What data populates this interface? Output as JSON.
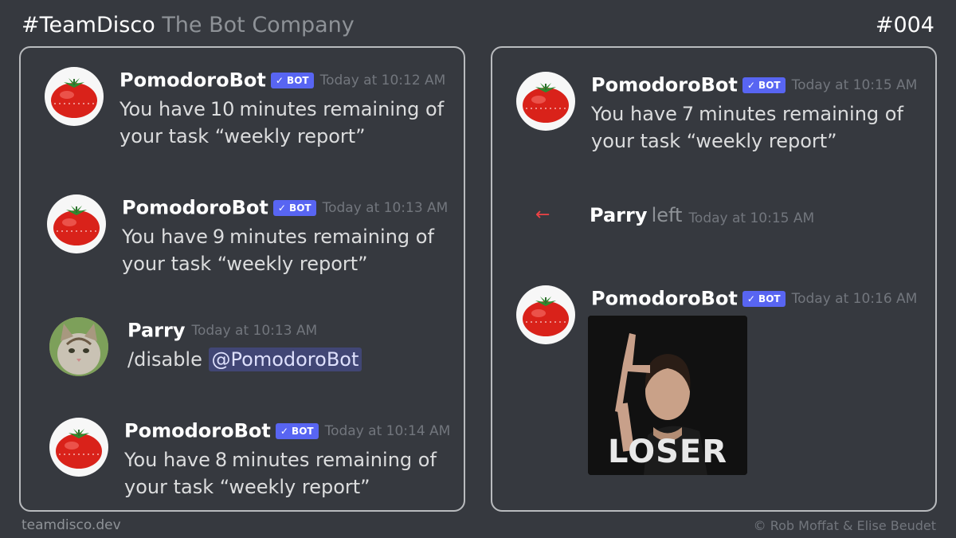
{
  "header": {
    "brand": "#TeamDisco",
    "subtitle": "The Bot Company",
    "episode": "#004"
  },
  "footer": {
    "site": "teamdisco.dev",
    "credit": "© Rob Moffat & Elise Beudet"
  },
  "bot_tag": "✓ BOT",
  "task_text": "minutes remaining of your task “weekly report”",
  "left_panel": {
    "messages": [
      {
        "author": "PomodoroBot",
        "time": "Today at 10:12 AM",
        "prefix": "You have",
        "minutes": "10"
      },
      {
        "author": "PomodoroBot",
        "time": "Today at 10:13 AM",
        "prefix": "You have",
        "minutes": "9"
      },
      {
        "author": "Parry",
        "time": "Today at 10:13 AM",
        "command": "/disable",
        "mention": "@PomodoroBot"
      },
      {
        "author": "PomodoroBot",
        "time": "Today at 10:14 AM",
        "prefix": "You have",
        "minutes": "8"
      }
    ]
  },
  "right_panel": {
    "messages": [
      {
        "author": "PomodoroBot",
        "time": "Today at 10:15 AM",
        "prefix": "You have",
        "minutes": "7"
      },
      {
        "user": "Parry",
        "action": "left",
        "time": "Today at 10:15 AM",
        "icon": "leave-arrow-icon",
        "icon_glyph": "←"
      },
      {
        "author": "PomodoroBot",
        "time": "Today at 10:16 AM",
        "gif_caption": "LOSER"
      }
    ]
  },
  "colors": {
    "background": "#36393f",
    "bot_tag": "#5865f2",
    "mention_bg": "#414675",
    "leave_arrow": "#ed4245",
    "tomato": "#d9221a"
  }
}
